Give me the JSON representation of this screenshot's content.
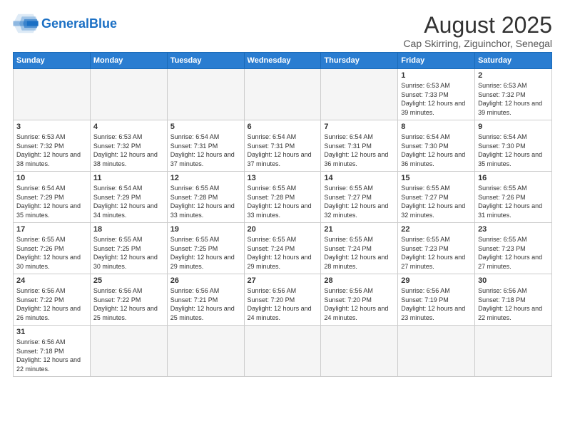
{
  "header": {
    "logo_general": "General",
    "logo_blue": "Blue",
    "month_year": "August 2025",
    "location": "Cap Skirring, Ziguinchor, Senegal"
  },
  "weekdays": [
    "Sunday",
    "Monday",
    "Tuesday",
    "Wednesday",
    "Thursday",
    "Friday",
    "Saturday"
  ],
  "weeks": [
    [
      {
        "day": "",
        "info": ""
      },
      {
        "day": "",
        "info": ""
      },
      {
        "day": "",
        "info": ""
      },
      {
        "day": "",
        "info": ""
      },
      {
        "day": "",
        "info": ""
      },
      {
        "day": "1",
        "info": "Sunrise: 6:53 AM\nSunset: 7:33 PM\nDaylight: 12 hours and 39 minutes."
      },
      {
        "day": "2",
        "info": "Sunrise: 6:53 AM\nSunset: 7:32 PM\nDaylight: 12 hours and 39 minutes."
      }
    ],
    [
      {
        "day": "3",
        "info": "Sunrise: 6:53 AM\nSunset: 7:32 PM\nDaylight: 12 hours and 38 minutes."
      },
      {
        "day": "4",
        "info": "Sunrise: 6:53 AM\nSunset: 7:32 PM\nDaylight: 12 hours and 38 minutes."
      },
      {
        "day": "5",
        "info": "Sunrise: 6:54 AM\nSunset: 7:31 PM\nDaylight: 12 hours and 37 minutes."
      },
      {
        "day": "6",
        "info": "Sunrise: 6:54 AM\nSunset: 7:31 PM\nDaylight: 12 hours and 37 minutes."
      },
      {
        "day": "7",
        "info": "Sunrise: 6:54 AM\nSunset: 7:31 PM\nDaylight: 12 hours and 36 minutes."
      },
      {
        "day": "8",
        "info": "Sunrise: 6:54 AM\nSunset: 7:30 PM\nDaylight: 12 hours and 36 minutes."
      },
      {
        "day": "9",
        "info": "Sunrise: 6:54 AM\nSunset: 7:30 PM\nDaylight: 12 hours and 35 minutes."
      }
    ],
    [
      {
        "day": "10",
        "info": "Sunrise: 6:54 AM\nSunset: 7:29 PM\nDaylight: 12 hours and 35 minutes."
      },
      {
        "day": "11",
        "info": "Sunrise: 6:54 AM\nSunset: 7:29 PM\nDaylight: 12 hours and 34 minutes."
      },
      {
        "day": "12",
        "info": "Sunrise: 6:55 AM\nSunset: 7:28 PM\nDaylight: 12 hours and 33 minutes."
      },
      {
        "day": "13",
        "info": "Sunrise: 6:55 AM\nSunset: 7:28 PM\nDaylight: 12 hours and 33 minutes."
      },
      {
        "day": "14",
        "info": "Sunrise: 6:55 AM\nSunset: 7:27 PM\nDaylight: 12 hours and 32 minutes."
      },
      {
        "day": "15",
        "info": "Sunrise: 6:55 AM\nSunset: 7:27 PM\nDaylight: 12 hours and 32 minutes."
      },
      {
        "day": "16",
        "info": "Sunrise: 6:55 AM\nSunset: 7:26 PM\nDaylight: 12 hours and 31 minutes."
      }
    ],
    [
      {
        "day": "17",
        "info": "Sunrise: 6:55 AM\nSunset: 7:26 PM\nDaylight: 12 hours and 30 minutes."
      },
      {
        "day": "18",
        "info": "Sunrise: 6:55 AM\nSunset: 7:25 PM\nDaylight: 12 hours and 30 minutes."
      },
      {
        "day": "19",
        "info": "Sunrise: 6:55 AM\nSunset: 7:25 PM\nDaylight: 12 hours and 29 minutes."
      },
      {
        "day": "20",
        "info": "Sunrise: 6:55 AM\nSunset: 7:24 PM\nDaylight: 12 hours and 29 minutes."
      },
      {
        "day": "21",
        "info": "Sunrise: 6:55 AM\nSunset: 7:24 PM\nDaylight: 12 hours and 28 minutes."
      },
      {
        "day": "22",
        "info": "Sunrise: 6:55 AM\nSunset: 7:23 PM\nDaylight: 12 hours and 27 minutes."
      },
      {
        "day": "23",
        "info": "Sunrise: 6:55 AM\nSunset: 7:23 PM\nDaylight: 12 hours and 27 minutes."
      }
    ],
    [
      {
        "day": "24",
        "info": "Sunrise: 6:56 AM\nSunset: 7:22 PM\nDaylight: 12 hours and 26 minutes."
      },
      {
        "day": "25",
        "info": "Sunrise: 6:56 AM\nSunset: 7:22 PM\nDaylight: 12 hours and 25 minutes."
      },
      {
        "day": "26",
        "info": "Sunrise: 6:56 AM\nSunset: 7:21 PM\nDaylight: 12 hours and 25 minutes."
      },
      {
        "day": "27",
        "info": "Sunrise: 6:56 AM\nSunset: 7:20 PM\nDaylight: 12 hours and 24 minutes."
      },
      {
        "day": "28",
        "info": "Sunrise: 6:56 AM\nSunset: 7:20 PM\nDaylight: 12 hours and 24 minutes."
      },
      {
        "day": "29",
        "info": "Sunrise: 6:56 AM\nSunset: 7:19 PM\nDaylight: 12 hours and 23 minutes."
      },
      {
        "day": "30",
        "info": "Sunrise: 6:56 AM\nSunset: 7:18 PM\nDaylight: 12 hours and 22 minutes."
      }
    ],
    [
      {
        "day": "31",
        "info": "Sunrise: 6:56 AM\nSunset: 7:18 PM\nDaylight: 12 hours and 22 minutes."
      },
      {
        "day": "",
        "info": ""
      },
      {
        "day": "",
        "info": ""
      },
      {
        "day": "",
        "info": ""
      },
      {
        "day": "",
        "info": ""
      },
      {
        "day": "",
        "info": ""
      },
      {
        "day": "",
        "info": ""
      }
    ]
  ]
}
